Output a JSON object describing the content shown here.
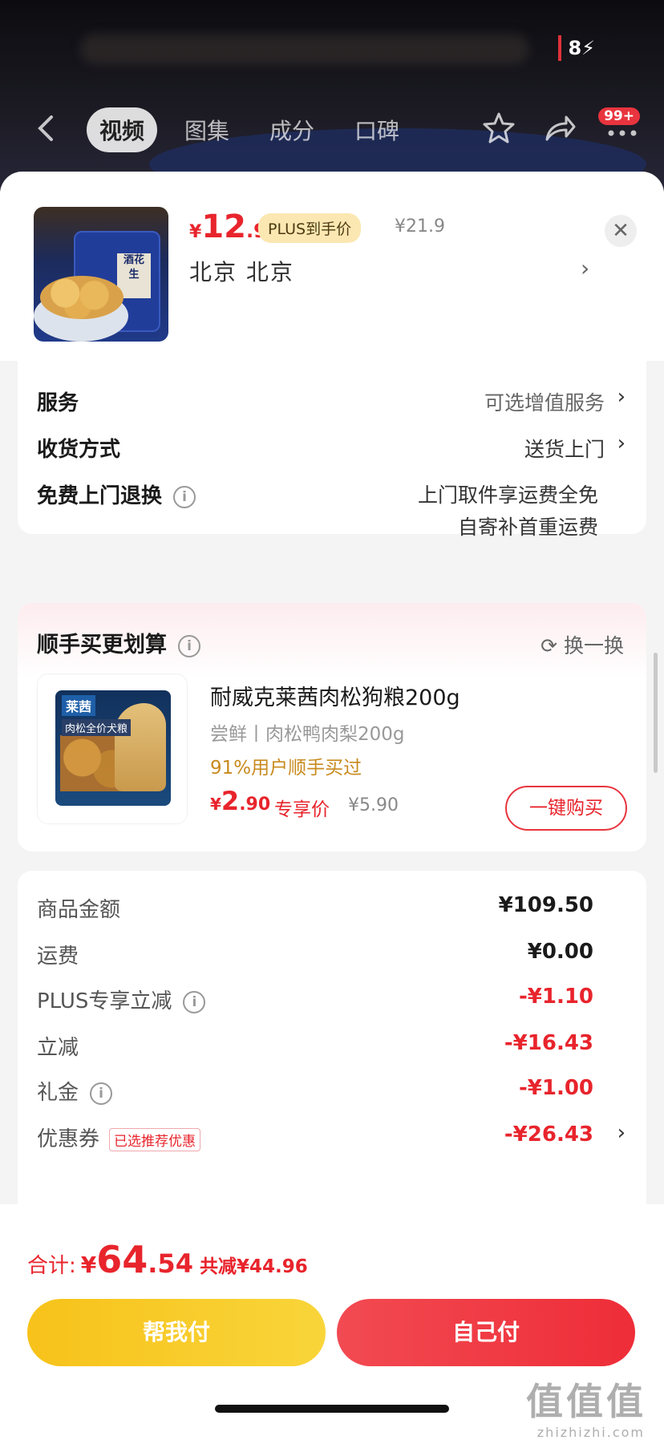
{
  "status": {
    "battery": "8"
  },
  "nav": {
    "tabs": [
      {
        "label": "视频",
        "active": true
      },
      {
        "label": "图集",
        "active": false
      },
      {
        "label": "成分",
        "active": false
      },
      {
        "label": "口碑",
        "active": false
      }
    ],
    "badge": "99+"
  },
  "product": {
    "price_symbol": "¥",
    "price_int": "12",
    "price_dec": ".9",
    "plus_tag": "PLUS到手价",
    "original_price": "¥21.9",
    "address": "北京  北京"
  },
  "options": {
    "service_label": "服务",
    "service_value": "可选增值服务",
    "delivery_label": "收货方式",
    "delivery_value": "送货上门",
    "return_label": "免费上门退换",
    "return_line1": "上门取件享运费全免",
    "return_line2": "自寄补首重运费"
  },
  "addon": {
    "title": "顺手买更划算",
    "refresh_label": "换一换",
    "product_name": "耐威克莱茜肉松狗粮200g",
    "spec": "尝鲜丨肉松鸭肉梨200g",
    "bought_text": "91%用户顺手买过",
    "price_symbol": "¥",
    "price_int": "2",
    "price_dec": ".90",
    "exclusive_label": "专享价",
    "original_price": "¥5.90",
    "buy_button": "一键购买",
    "image_brand": "莱茜",
    "image_name": "肉松全价犬粮"
  },
  "summary": {
    "items": [
      {
        "label": "商品金额",
        "value": "¥109.50"
      },
      {
        "label": "运费",
        "value": "¥0.00"
      },
      {
        "label": "PLUS专享立减",
        "value": "-¥1.10"
      },
      {
        "label": "立减",
        "value": "-¥16.43"
      },
      {
        "label": "礼金",
        "value": "-¥1.00"
      },
      {
        "label": "优惠券",
        "value": "-¥26.43",
        "tag": "已选推荐优惠"
      }
    ]
  },
  "footer": {
    "total_label": "合计:",
    "total_symbol": "¥",
    "total_int": "64",
    "total_dec": ".54",
    "savings": "共减¥44.96",
    "help_pay": "帮我付",
    "self_pay": "自己付"
  },
  "watermark": {
    "main": "值值值",
    "sub": "zhizhizhi.com"
  },
  "colors": {
    "accent_red": "#e8242c",
    "plus_gold": "#fbe7b1",
    "help_yellow": "#f7c21a"
  }
}
